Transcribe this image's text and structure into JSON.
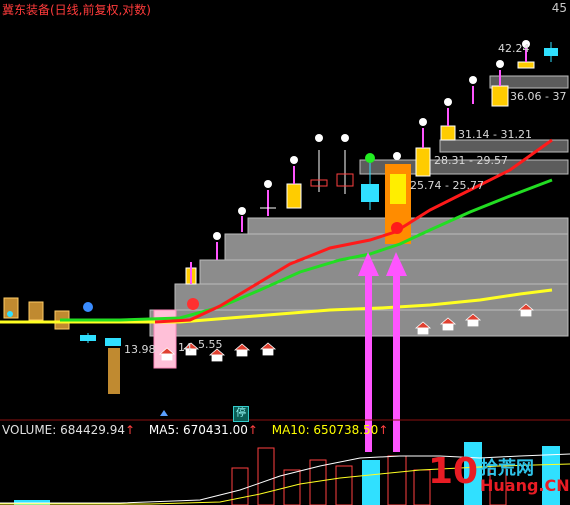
{
  "window": {
    "title": "冀东装备(日线,前复权,对数)",
    "top_price": "45"
  },
  "price_labels": {
    "p1": "42.24",
    "p2": "36.06 - 37",
    "p3": "31.14 - 31.21",
    "p4": "28.31 - 29.57",
    "p5": "25.74 - 25.77",
    "p6": "13.98",
    "p7": "14",
    "p8": "5.55"
  },
  "volume_bar": {
    "volume_label": "VOLUME: 684429.94",
    "ma5_label": "MA5: 670431.00",
    "ma10_label": "MA10: 650738.50",
    "colors": {
      "volume": "#e0e0e0",
      "ma5": "#ffffff",
      "ma10": "#ffff00",
      "arrow": "#ff4040"
    }
  },
  "badges": {
    "halt": "停"
  },
  "watermark": {
    "ten": "10",
    "cn": "拾荒网",
    "url": "Huang.CN"
  },
  "colors": {
    "red_line": "#ff1a1a",
    "green_line": "#22dd22",
    "yellow_line": "#ffff22",
    "up": "#ffcc00",
    "down": "#30e0ff",
    "arrow": "#ff55ff"
  }
}
